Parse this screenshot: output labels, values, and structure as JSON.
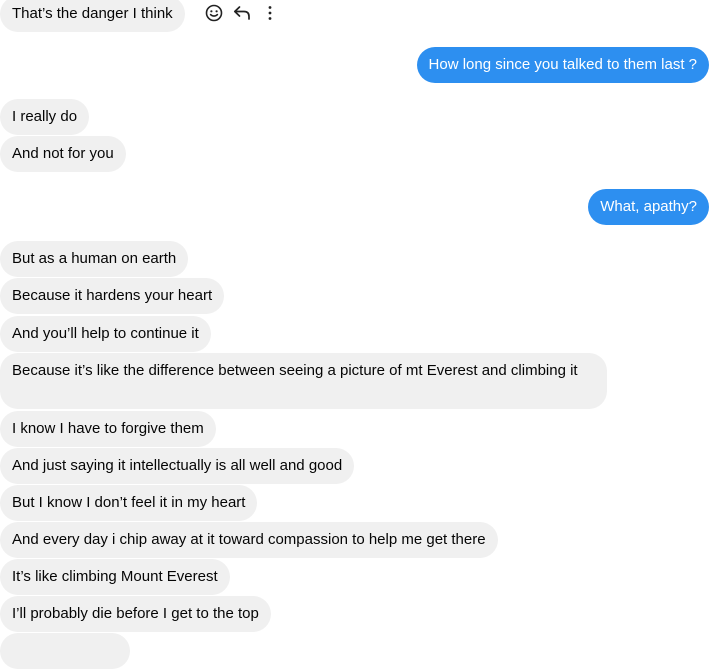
{
  "messages": [
    {
      "side": "received",
      "text": "That’s the danger I think"
    },
    {
      "side": "sent",
      "text": "How long since you talked to them last ?"
    },
    {
      "side": "received",
      "text": "I really do"
    },
    {
      "side": "received",
      "text": "And not for you"
    },
    {
      "side": "sent",
      "text": "What, apathy?"
    },
    {
      "side": "received",
      "text": "But as a human on earth"
    },
    {
      "side": "received",
      "text": "Because it hardens your heart"
    },
    {
      "side": "received",
      "text": "And you’ll help to continue it"
    },
    {
      "side": "received",
      "text": "Because it’s like the difference between seeing a picture of mt Everest and climbing it"
    },
    {
      "side": "received",
      "text": "I know I have to forgive them"
    },
    {
      "side": "received",
      "text": "And just saying it intellectually is all well and good"
    },
    {
      "side": "received",
      "text": "But I know I don’t feel it in my heart"
    },
    {
      "side": "received",
      "text": "And every day i chip away at it toward compassion to help me get there"
    },
    {
      "side": "received",
      "text": "It’s like climbing Mount Everest"
    },
    {
      "side": "received",
      "text": "I’ll probably die before I get to the top"
    }
  ],
  "hover_actions": {
    "icons": [
      "emoji-icon",
      "reply-icon",
      "more-icon"
    ]
  },
  "colors": {
    "received_bubble": "#f0f0f0",
    "sent_bubble": "#2d8ff0",
    "received_text": "#050505",
    "sent_text": "#ffffff"
  }
}
